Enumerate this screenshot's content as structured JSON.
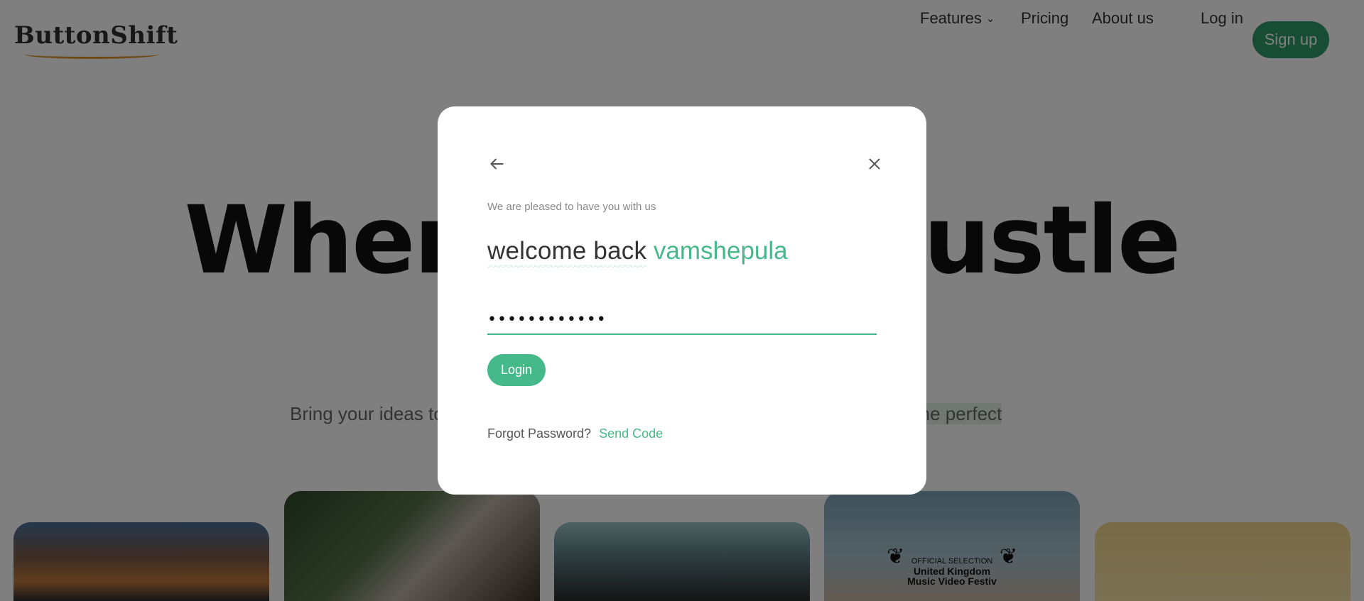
{
  "header": {
    "logo_text": "ButtonShift",
    "nav": {
      "features": "Features",
      "pricing": "Pricing",
      "about": "About us",
      "login": "Log in",
      "signup": "Sign up"
    }
  },
  "hero": {
    "title": "Where ideas hustle",
    "subtitle_start": "Bring your ideas to ",
    "subtitle_end": "ite with the perfect"
  },
  "gallery": {
    "card4_badge_top": "OFFICIAL SELECTION",
    "card4_badge_main": "United Kingdom",
    "card4_badge_sub": "Music Video Festiv"
  },
  "modal": {
    "tagline": "We are pleased to have you with us",
    "welcome_text": "welcome back",
    "username": "vamshepula",
    "password_value": "••••••••••••",
    "login_label": "Login",
    "forgot_label": "Forgot Password?",
    "send_code_label": "Send Code"
  },
  "colors": {
    "accent": "#45b98a",
    "signup_bg": "#2e9a68",
    "overlay": "rgba(0,0,0,0.5)"
  },
  "icons": {
    "back": "arrow-left-icon",
    "close": "close-icon",
    "features_chevron": "chevron-down-icon"
  }
}
